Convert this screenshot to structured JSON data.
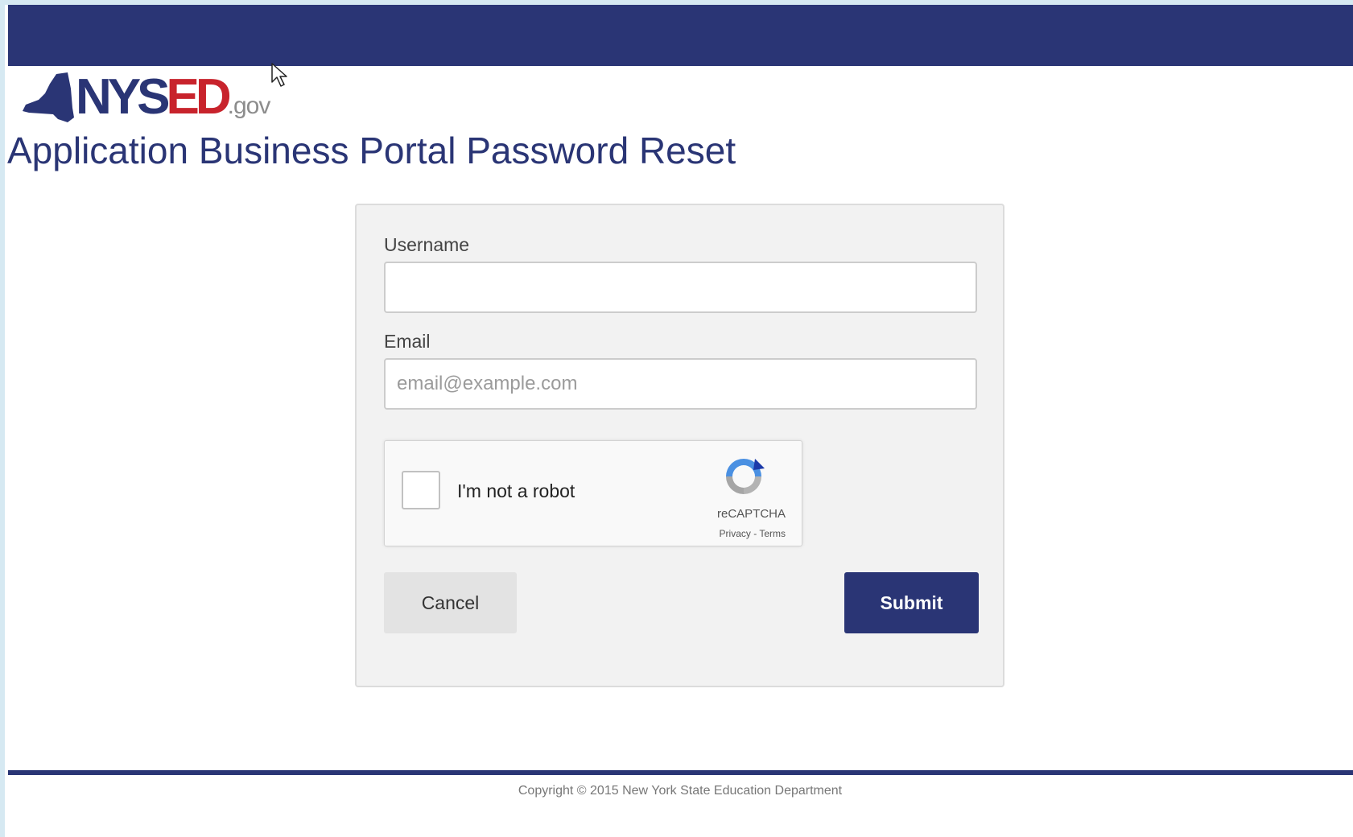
{
  "header": {
    "logo_text_primary": "NYS",
    "logo_text_accent": "ED",
    "logo_text_suffix": ".gov"
  },
  "page": {
    "title": "Application Business Portal Password Reset"
  },
  "form": {
    "username_label": "Username",
    "username_value": "",
    "email_label": "Email",
    "email_value": "",
    "email_placeholder": "email@example.com",
    "recaptcha": {
      "checkbox_label": "I'm not a robot",
      "brand": "reCAPTCHA",
      "privacy_link": "Privacy",
      "separator": " - ",
      "terms_link": "Terms"
    },
    "cancel_label": "Cancel",
    "submit_label": "Submit"
  },
  "footer": {
    "copyright": "Copyright © 2015 New York State Education Department"
  },
  "colors": {
    "brand_navy": "#2a3575",
    "brand_red": "#c8232c",
    "card_background": "#f2f2f2"
  },
  "icons": [
    "ny-state-map-icon",
    "recaptcha-logo-icon",
    "mouse-cursor-icon"
  ]
}
